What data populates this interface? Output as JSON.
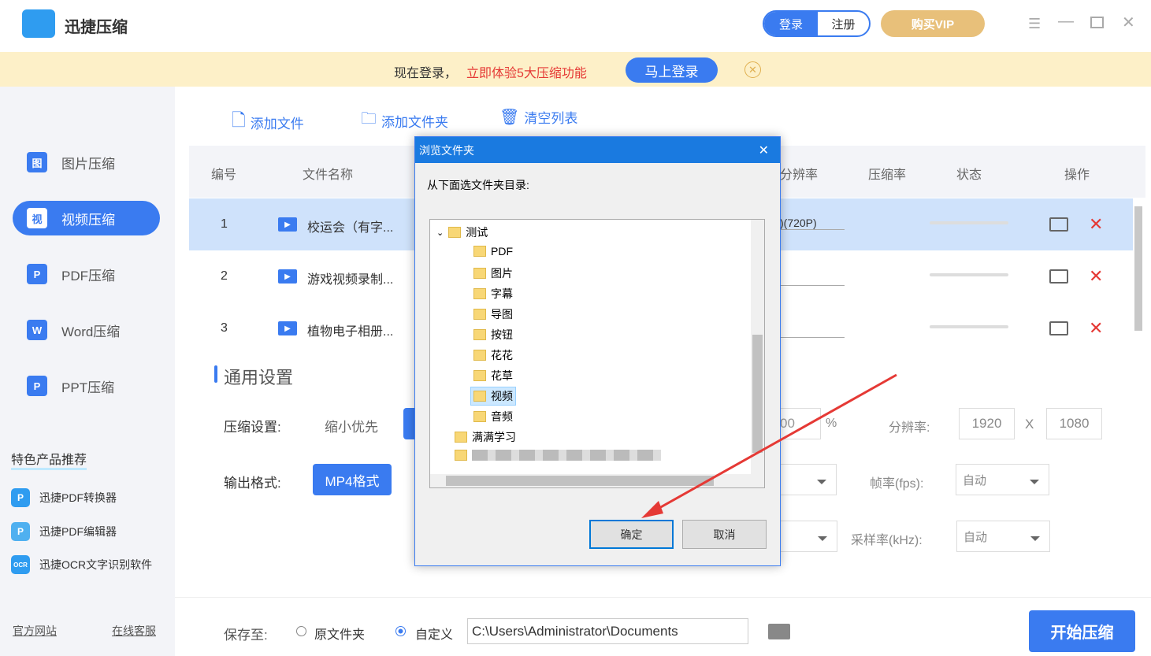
{
  "app": {
    "title": "迅捷压缩",
    "login": "登录",
    "register": "注册",
    "vip": "购买VIP"
  },
  "banner": {
    "text": "现在登录，",
    "highlight": "立即体验5大压缩功能",
    "button": "马上登录"
  },
  "sidebar": {
    "items": [
      {
        "label": "图片压缩",
        "icon": "图"
      },
      {
        "label": "视频压缩",
        "icon": "视"
      },
      {
        "label": "PDF压缩",
        "icon": "P"
      },
      {
        "label": "Word压缩",
        "icon": "W"
      },
      {
        "label": "PPT压缩",
        "icon": "P"
      }
    ],
    "rec_title": "特色产品推荐",
    "recs": [
      {
        "label": "迅捷PDF转换器",
        "icon": "P"
      },
      {
        "label": "迅捷PDF编辑器",
        "icon": "P"
      },
      {
        "label": "迅捷OCR文字识别软件",
        "icon": "OCR"
      }
    ],
    "footer": {
      "site": "官方网站",
      "service": "在线客服"
    }
  },
  "toolbar": {
    "add_file": "添加文件",
    "add_folder": "添加文件夹",
    "clear": "清空列表"
  },
  "table": {
    "headers": [
      "编号",
      "文件名称",
      "分辨率",
      "压缩率",
      "状态",
      "操作"
    ],
    "rows": [
      {
        "no": "1",
        "name": "校运会（有字...",
        "res": ")(720P)"
      },
      {
        "no": "2",
        "name": "游戏视频录制...",
        "res": ""
      },
      {
        "no": "3",
        "name": "植物电子相册...",
        "res": ""
      }
    ]
  },
  "settings": {
    "title": "通用设置",
    "compress_label": "压缩设置:",
    "compress_value": "缩小优先",
    "format_label": "输出格式:",
    "format_value": "MP4格式",
    "quality": "00",
    "percent": "%",
    "res_label": "分辨率:",
    "width": "1920",
    "x": "X",
    "height": "1080",
    "fps_label": "帧率(fps):",
    "fps_value": "自动",
    "sample_label": "采样率(kHz):",
    "sample_value": "自动"
  },
  "bottom": {
    "save_label": "保存至:",
    "opt_original": "原文件夹",
    "opt_custom": "自定义",
    "path": "C:\\Users\\Administrator\\Documents",
    "start": "开始压缩"
  },
  "dialog": {
    "title": "浏览文件夹",
    "prompt": "从下面选文件夹目录:",
    "root": "测试",
    "children": [
      "PDF",
      "图片",
      "字幕",
      "导图",
      "按钮",
      "花花",
      "花草",
      "视频",
      "音频"
    ],
    "sibling": "满满学习",
    "ok": "确定",
    "cancel": "取消"
  }
}
